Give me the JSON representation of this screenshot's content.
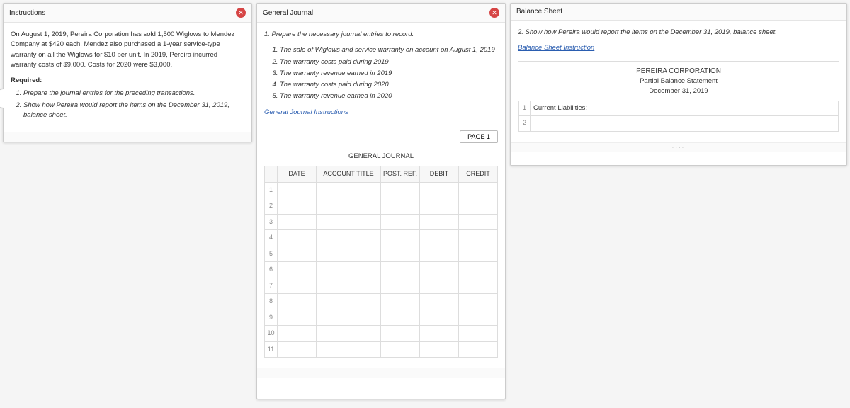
{
  "instructions": {
    "title": "Instructions",
    "body_p1": "On August 1, 2019, Pereira Corporation has sold 1,500 Wiglows to Mendez Company at $420 each. Mendez also purchased a 1-year service-type warranty on all the Wiglows for $10 per unit. In 2019, Pereira incurred warranty costs of $9,000. Costs for 2020 were $3,000.",
    "required_label": "Required:",
    "required_items": [
      "Prepare the journal entries for the preceding transactions.",
      "Show how Pereira would report the items on the December 31, 2019, balance sheet."
    ]
  },
  "general_journal": {
    "title": "General Journal",
    "intro": "1. Prepare the necessary journal entries to record:",
    "sub_items": [
      "The sale of Wiglows and service warranty on account on August 1, 2019",
      "The warranty costs paid during 2019",
      "The warranty revenue earned in 2019",
      "The warranty costs paid during 2020",
      "The warranty revenue earned in 2020"
    ],
    "instructions_link": "General Journal Instructions",
    "page_label": "PAGE 1",
    "table_title": "GENERAL JOURNAL",
    "columns": {
      "date": "DATE",
      "account_title": "ACCOUNT TITLE",
      "post_ref": "POST. REF.",
      "debit": "DEBIT",
      "credit": "CREDIT"
    },
    "row_count": 11
  },
  "balance_sheet": {
    "title": "Balance Sheet",
    "intro": "2. Show how Pereira would report the items on the December 31, 2019, balance sheet.",
    "instructions_link": "Balance Sheet Instruction",
    "company": "PEREIRA CORPORATION",
    "statement": "Partial Balance Statement",
    "date": "December 31, 2019",
    "rows": [
      {
        "num": "1",
        "label": "Current Liabilities:",
        "amount": ""
      },
      {
        "num": "2",
        "label": "",
        "amount": ""
      }
    ]
  }
}
